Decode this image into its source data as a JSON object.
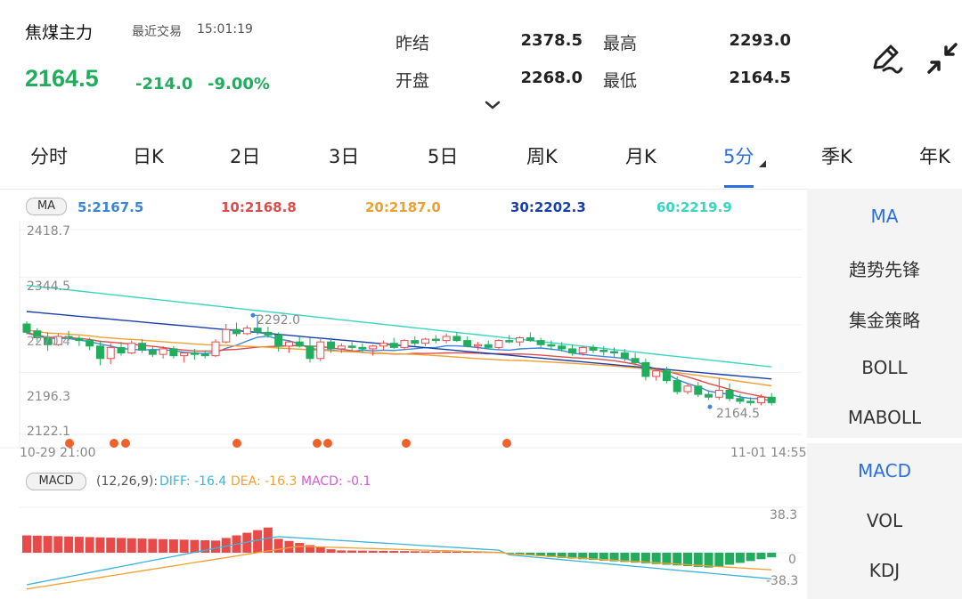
{
  "header": {
    "title": "焦煤主力",
    "last_trade_label": "最近交易",
    "last_trade_time": "15:01:19",
    "price": "2164.5",
    "change": "-214.0",
    "change_pct": "-9.00%",
    "stats": [
      {
        "label": "昨结",
        "value": "2378.5"
      },
      {
        "label": "最高",
        "value": "2293.0"
      },
      {
        "label": "开盘",
        "value": "2268.0"
      },
      {
        "label": "最低",
        "value": "2164.5"
      }
    ],
    "up_color": "#e84a4a",
    "down_color": "#22ac5e"
  },
  "tabs": [
    {
      "label": "分时"
    },
    {
      "label": "日K"
    },
    {
      "label": "2日"
    },
    {
      "label": "3日"
    },
    {
      "label": "5日"
    },
    {
      "label": "周K"
    },
    {
      "label": "月K"
    },
    {
      "label": "5分",
      "active": true
    },
    {
      "label": "季K"
    },
    {
      "label": "年K"
    }
  ],
  "ma_legend": {
    "badge": "MA",
    "items": [
      {
        "text": "5:2167.5",
        "color": "#3a86d8"
      },
      {
        "text": "10:2168.8",
        "color": "#e04b4b"
      },
      {
        "text": "20:2187.0",
        "color": "#f0a030"
      },
      {
        "text": "30:2202.3",
        "color": "#1a3fa8"
      },
      {
        "text": "60:2219.9",
        "color": "#3ad6c0"
      }
    ]
  },
  "main_chart": {
    "y_ticks": [
      "2418.7",
      "2344.5",
      "2270.4",
      "2196.3",
      "2122.1"
    ],
    "x_start": "10-29 21:00",
    "x_end": "11-01 14:55",
    "max_annotation": "2292.0",
    "min_annotation": "2164.5",
    "ylim": [
      2122.1,
      2418.7
    ]
  },
  "macd_legend": {
    "badge": "MACD",
    "params": "(12,26,9):",
    "diff": "DIFF: -16.4",
    "dea": "DEA: -16.3",
    "macd": "MACD: -0.1",
    "diff_color": "#3ab4d8",
    "dea_color": "#f0a030",
    "macd_color": "#d35bd3"
  },
  "macd_chart": {
    "y_ticks": [
      "38.3",
      "0",
      "-38.3"
    ],
    "ylim": [
      -38.3,
      38.3
    ]
  },
  "indicator_panel": {
    "main": [
      "MA",
      "趋势先锋",
      "集金策略",
      "BOLL",
      "MABOLL"
    ],
    "sub": [
      "MACD",
      "VOL",
      "KDJ"
    ]
  },
  "chart_data": [
    {
      "type": "candlestick",
      "y_range": [
        2122.1,
        2418.7
      ],
      "candles": [
        [
          2282,
          2286,
          2267,
          2270
        ],
        [
          2272,
          2276,
          2256,
          2262
        ],
        [
          2262,
          2270,
          2243,
          2252
        ],
        [
          2252,
          2268,
          2250,
          2264
        ],
        [
          2264,
          2272,
          2258,
          2261
        ],
        [
          2261,
          2265,
          2250,
          2258
        ],
        [
          2258,
          2262,
          2244,
          2250
        ],
        [
          2250,
          2258,
          2222,
          2232
        ],
        [
          2232,
          2254,
          2224,
          2248
        ],
        [
          2248,
          2256,
          2236,
          2240
        ],
        [
          2240,
          2258,
          2238,
          2254
        ],
        [
          2254,
          2260,
          2240,
          2244
        ],
        [
          2244,
          2250,
          2234,
          2238
        ],
        [
          2238,
          2250,
          2232,
          2246
        ],
        [
          2246,
          2250,
          2232,
          2236
        ],
        [
          2236,
          2240,
          2226,
          2240
        ],
        [
          2240,
          2246,
          2230,
          2238
        ],
        [
          2238,
          2244,
          2232,
          2236
        ],
        [
          2236,
          2260,
          2234,
          2256
        ],
        [
          2256,
          2282,
          2254,
          2274
        ],
        [
          2274,
          2284,
          2264,
          2268
        ],
        [
          2268,
          2280,
          2266,
          2276
        ],
        [
          2276,
          2292,
          2270,
          2270
        ],
        [
          2270,
          2278,
          2262,
          2266
        ],
        [
          2266,
          2270,
          2242,
          2250
        ],
        [
          2250,
          2258,
          2240,
          2256
        ],
        [
          2256,
          2264,
          2248,
          2250
        ],
        [
          2250,
          2262,
          2226,
          2232
        ],
        [
          2232,
          2260,
          2228,
          2256
        ],
        [
          2256,
          2262,
          2240,
          2246
        ],
        [
          2246,
          2254,
          2240,
          2250
        ],
        [
          2250,
          2256,
          2244,
          2248
        ],
        [
          2248,
          2254,
          2240,
          2246
        ],
        [
          2246,
          2252,
          2236,
          2250
        ],
        [
          2250,
          2258,
          2244,
          2254
        ],
        [
          2254,
          2262,
          2246,
          2248
        ],
        [
          2248,
          2260,
          2244,
          2258
        ],
        [
          2258,
          2264,
          2250,
          2254
        ],
        [
          2254,
          2262,
          2250,
          2260
        ],
        [
          2260,
          2266,
          2254,
          2258
        ],
        [
          2258,
          2268,
          2254,
          2264
        ],
        [
          2264,
          2270,
          2256,
          2258
        ],
        [
          2258,
          2264,
          2248,
          2250
        ],
        [
          2250,
          2256,
          2244,
          2252
        ],
        [
          2252,
          2258,
          2246,
          2248
        ],
        [
          2248,
          2260,
          2244,
          2258
        ],
        [
          2258,
          2266,
          2254,
          2256
        ],
        [
          2256,
          2264,
          2250,
          2262
        ],
        [
          2262,
          2270,
          2256,
          2258
        ],
        [
          2258,
          2262,
          2248,
          2252
        ],
        [
          2252,
          2258,
          2244,
          2250
        ],
        [
          2250,
          2256,
          2242,
          2246
        ],
        [
          2246,
          2252,
          2236,
          2240
        ],
        [
          2240,
          2250,
          2236,
          2248
        ],
        [
          2248,
          2252,
          2240,
          2244
        ],
        [
          2244,
          2250,
          2236,
          2242
        ],
        [
          2242,
          2248,
          2234,
          2240
        ],
        [
          2240,
          2246,
          2228,
          2232
        ],
        [
          2232,
          2240,
          2222,
          2226
        ],
        [
          2226,
          2232,
          2200,
          2206
        ],
        [
          2206,
          2218,
          2200,
          2214
        ],
        [
          2214,
          2220,
          2196,
          2200
        ],
        [
          2200,
          2206,
          2180,
          2184
        ],
        [
          2184,
          2196,
          2180,
          2192
        ],
        [
          2192,
          2198,
          2176,
          2180
        ],
        [
          2180,
          2186,
          2172,
          2176
        ],
        [
          2176,
          2204,
          2172,
          2186
        ],
        [
          2186,
          2196,
          2170,
          2174
        ],
        [
          2174,
          2180,
          2166,
          2170
        ],
        [
          2170,
          2176,
          2164,
          2168
        ],
        [
          2168,
          2180,
          2164,
          2176
        ],
        [
          2176,
          2182,
          2164,
          2168
        ]
      ],
      "ma_series": [
        {
          "name": "5",
          "start": 2262,
          "end": 2167.5
        },
        {
          "name": "10",
          "start": 2268,
          "end": 2168.8
        },
        {
          "name": "20",
          "start": 2275,
          "end": 2187.0
        },
        {
          "name": "30",
          "start": 2300,
          "end": 2202.3
        },
        {
          "name": "60",
          "start": 2338,
          "end": 2219.9
        }
      ]
    }
  ]
}
